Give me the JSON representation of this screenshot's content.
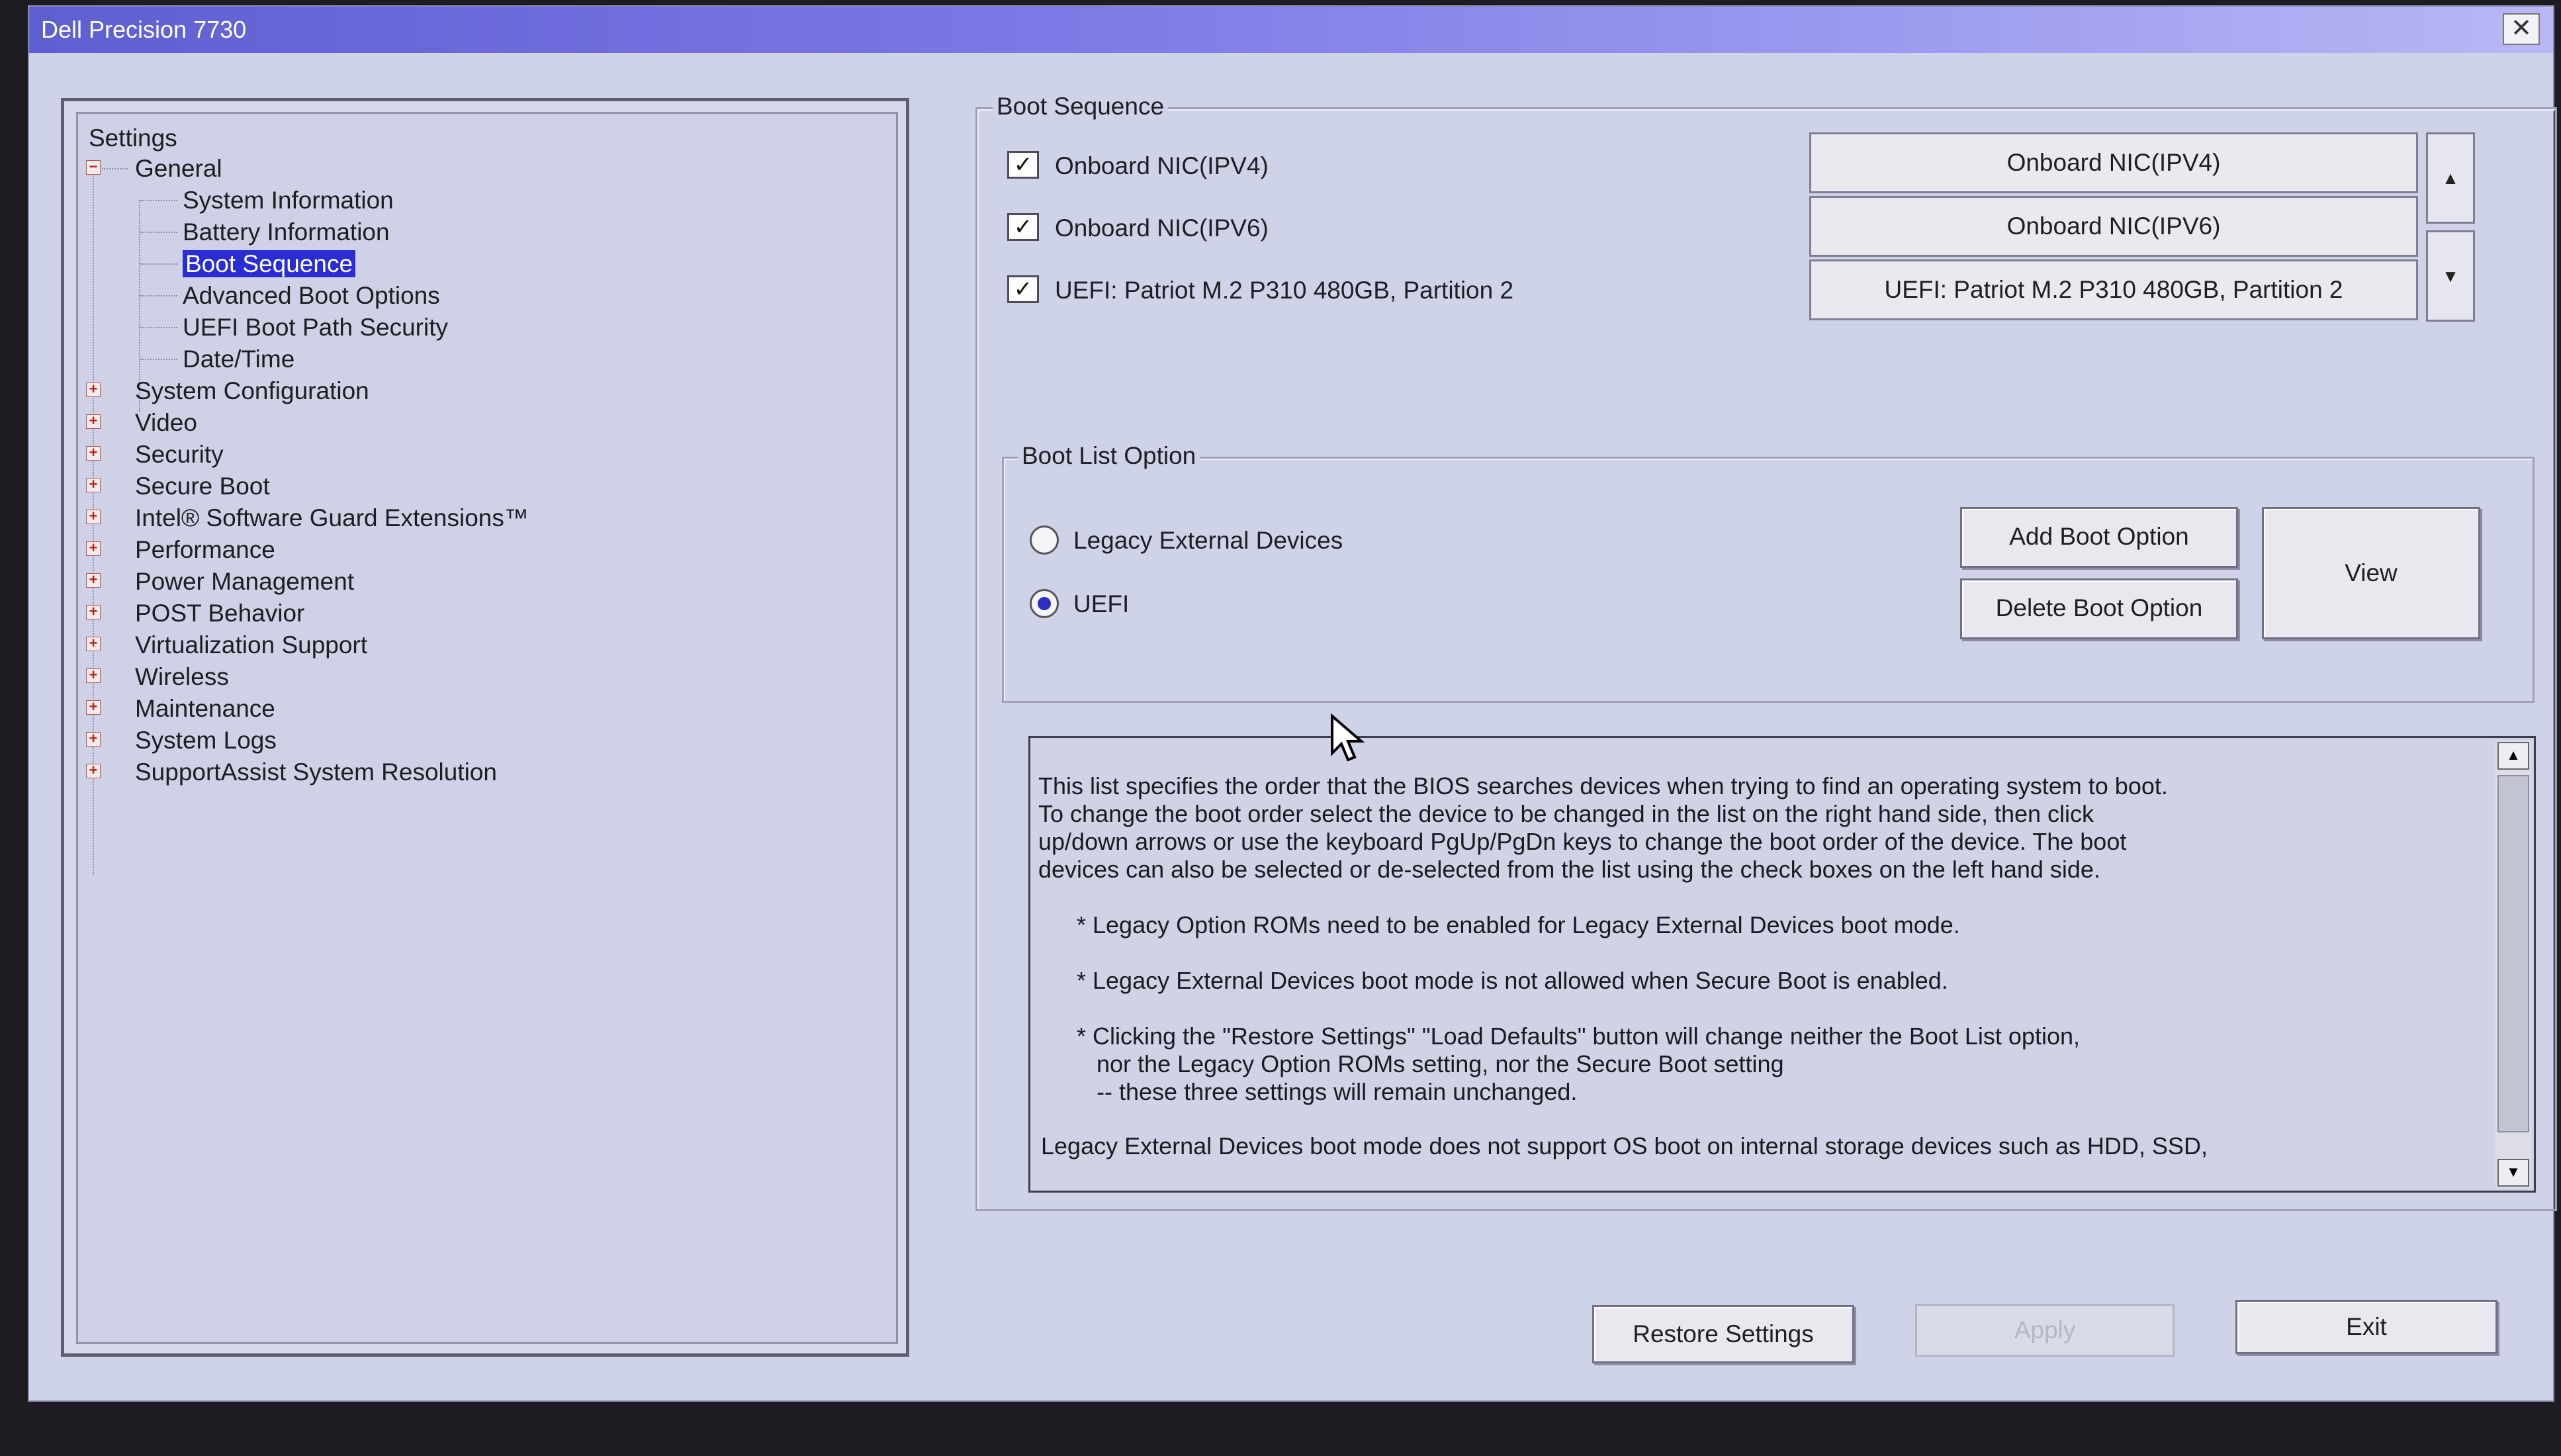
{
  "window": {
    "title": "Dell Precision 7730",
    "close_glyph": "✕"
  },
  "tree": {
    "root": "Settings",
    "general": "General",
    "general_children": [
      "System Information",
      "Battery Information",
      "Boot Sequence",
      "Advanced Boot Options",
      "UEFI Boot Path Security",
      "Date/Time"
    ],
    "selected": "Boot Sequence",
    "collapsed": [
      "System Configuration",
      "Video",
      "Security",
      "Secure Boot",
      "Intel® Software Guard Extensions™",
      "Performance",
      "Power Management",
      "POST Behavior",
      "Virtualization Support",
      "Wireless",
      "Maintenance",
      "System Logs",
      "SupportAssist System Resolution"
    ]
  },
  "boot_sequence": {
    "title": "Boot Sequence",
    "items": [
      {
        "label": "Onboard NIC(IPV4)",
        "checked": true
      },
      {
        "label": "Onboard NIC(IPV6)",
        "checked": true
      },
      {
        "label": "UEFI: Patriot M.2 P310 480GB, Partition 2",
        "checked": true
      }
    ],
    "order": [
      "Onboard NIC(IPV4)",
      "Onboard NIC(IPV6)",
      "UEFI: Patriot M.2 P310 480GB, Partition 2"
    ],
    "check_glyph": "✓",
    "up_glyph": "▲",
    "down_glyph": "▼"
  },
  "boot_list_option": {
    "title": "Boot List Option",
    "options": [
      "Legacy External Devices",
      "UEFI"
    ],
    "selected": "UEFI",
    "add_button": "Add Boot Option",
    "delete_button": "Delete Boot Option",
    "view_button": "View"
  },
  "description": {
    "paragraph": "This list specifies the order that the BIOS searches devices when trying to find an operating system to boot.\nTo change the boot order select the device to be changed in the list on the right hand side, then click\nup/down arrows or use the keyboard PgUp/PgDn keys to change the boot order of the device. The boot\ndevices can also be selected or de-selected from the list using the check boxes on the left hand side.",
    "note1": "* Legacy Option ROMs need to be enabled for Legacy External Devices boot mode.",
    "note2": "* Legacy External Devices boot mode is not allowed when Secure Boot is enabled.",
    "note3": "* Clicking the \"Restore Settings\" \"Load Defaults\" button will change neither the Boot List option,\n   nor the Legacy Option ROMs setting, nor the Secure Boot setting\n   -- these three settings will remain unchanged.",
    "footer": "Legacy External Devices boot mode does not support OS boot on internal storage devices such as HDD, SSD,"
  },
  "footer_buttons": {
    "restore": "Restore Settings",
    "apply": "Apply",
    "exit": "Exit"
  },
  "colors": {
    "titlebar_start": "#5e5fd0",
    "background": "#cfd3e8",
    "selection": "#2a2cd4"
  }
}
